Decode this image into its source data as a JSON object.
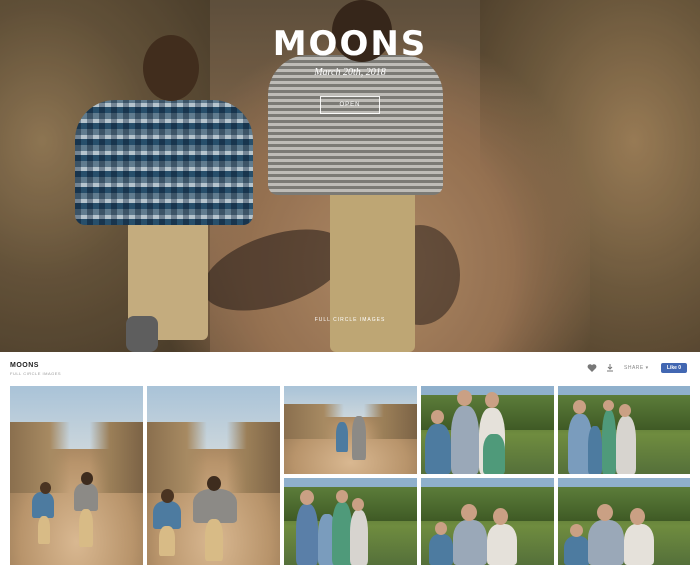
{
  "hero": {
    "title": "MOONS",
    "date": "March 20th, 2018",
    "open_label": "OPEN",
    "brand": "FULL CIRCLE IMAGES"
  },
  "header": {
    "title": "MOONS",
    "subtitle": "FULL CIRCLE IMAGES",
    "share_label": "SHARE ▾",
    "fb_label": "Like 0"
  },
  "icons": {
    "heart": "heart-icon",
    "download": "download-icon"
  },
  "colors": {
    "facebook": "#4267b2",
    "white": "#ffffff"
  }
}
